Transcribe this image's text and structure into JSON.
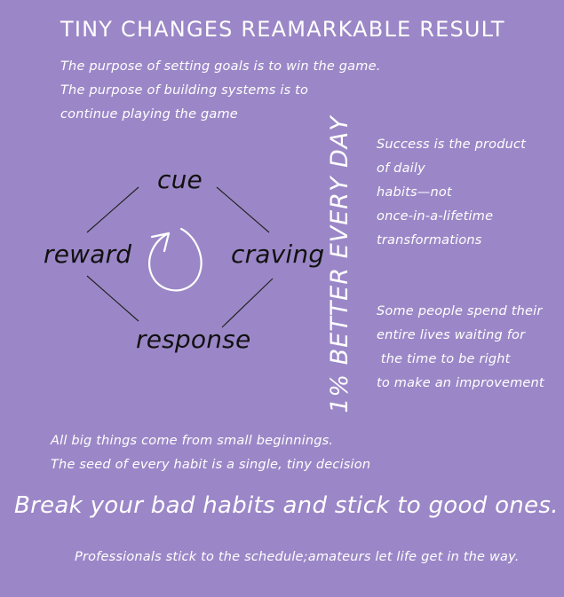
{
  "title": "TINY CHANGES REAMARKABLE RESULT",
  "quote_goals": "The purpose of setting goals is to win the game.\nThe purpose of building systems is to\ncontinue playing the game",
  "quote_success": "Success is the product\nof daily\nhabits—not\nonce-in-a-lifetime\ntransformations",
  "quote_waiting": "Some people spend their\nentire lives waiting for\n the time to be right\nto make an improvement",
  "quote_beginnings": "All big things come from small beginnings.\nThe seed of every habit is a single, tiny decision",
  "vertical_banner": "1% BETTER EVERY DAY",
  "headline": "Break your bad habits and stick to good ones.",
  "footer_quote": "Professionals stick to the schedule;amateurs let life get in the way.",
  "habit_loop": {
    "top": "cue",
    "right": "craving",
    "bottom": "response",
    "left": "reward",
    "center_icon": "cycle-arrow-icon"
  },
  "colors": {
    "background": "#9b87c7",
    "text": "#ffffff",
    "diagram": "#111111"
  }
}
